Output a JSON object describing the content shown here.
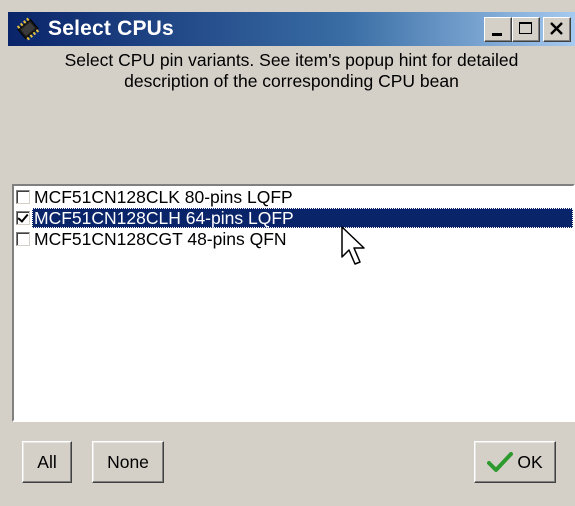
{
  "window": {
    "title": "Select CPUs",
    "icon": "chip-icon",
    "title_gradient": [
      "#0a246a",
      "#a6caf0"
    ]
  },
  "description": {
    "line1": "Select CPU pin variants. See item's popup hint for detailed",
    "line2": "description of the corresponding CPU bean"
  },
  "list": {
    "items": [
      {
        "label": "MCF51CN128CLK 80-pins LQFP",
        "checked": false,
        "selected": false
      },
      {
        "label": "MCF51CN128CLH 64-pins LQFP",
        "checked": true,
        "selected": true
      },
      {
        "label": "MCF51CN128CGT 48-pins QFN",
        "checked": false,
        "selected": false
      }
    ],
    "selection_color": "#0a246a"
  },
  "buttons": {
    "all_label": "All",
    "none_label": "None",
    "ok_label": "OK",
    "ok_icon": "checkmark-icon",
    "ok_icon_color": "#2e9a2e"
  }
}
